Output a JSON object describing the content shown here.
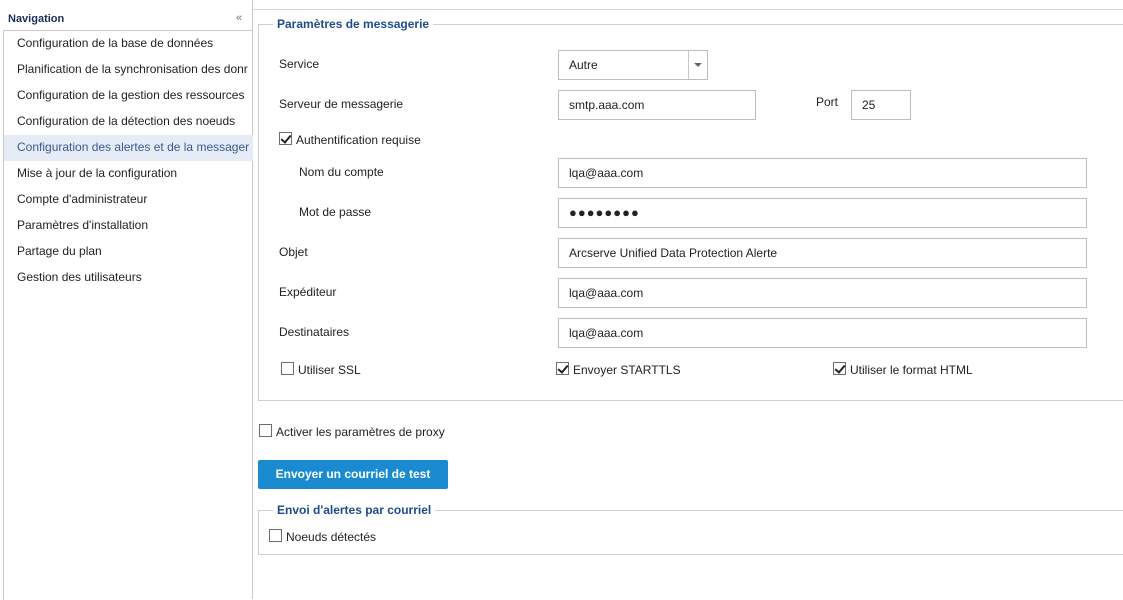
{
  "navigation": {
    "title": "Navigation",
    "items": [
      {
        "label": "Configuration de la base de données",
        "active": false
      },
      {
        "label": "Planification de la synchronisation des donr",
        "active": false
      },
      {
        "label": "Configuration de la gestion des ressources",
        "active": false
      },
      {
        "label": "Configuration de la détection des noeuds",
        "active": false
      },
      {
        "label": "Configuration des alertes et de la messager",
        "active": true
      },
      {
        "label": "Mise à jour de la configuration",
        "active": false
      },
      {
        "label": "Compte d'administrateur",
        "active": false
      },
      {
        "label": "Paramètres d'installation",
        "active": false
      },
      {
        "label": "Partage du plan",
        "active": false
      },
      {
        "label": "Gestion des utilisateurs",
        "active": false
      }
    ]
  },
  "mail": {
    "legend": "Paramètres de messagerie",
    "service_label": "Service",
    "service_value": "Autre",
    "server_label": "Serveur de messagerie",
    "server_value": "smtp.aaa.com",
    "port_label": "Port",
    "port_value": "25",
    "auth_label": "Authentification requise",
    "auth_checked": true,
    "account_label": "Nom du compte",
    "account_value": "lqa@aaa.com",
    "password_label": "Mot de passe",
    "password_value": "●●●●●●●●",
    "subject_label": "Objet",
    "subject_value": "Arcserve Unified Data Protection Alerte",
    "sender_label": "Expéditeur",
    "sender_value": "lqa@aaa.com",
    "recipients_label": "Destinataires",
    "recipients_value": "lqa@aaa.com",
    "ssl_label": "Utiliser SSL",
    "ssl_checked": false,
    "starttls_label": "Envoyer STARTTLS",
    "starttls_checked": true,
    "html_label": "Utiliser le format HTML",
    "html_checked": true
  },
  "proxy": {
    "label": "Activer les paramètres de proxy",
    "checked": false
  },
  "test_button_label": "Envoyer un courriel de test",
  "alerts": {
    "legend": "Envoi d'alertes par courriel",
    "nodes_label": "Noeuds détectés",
    "nodes_checked": false
  },
  "icons": {
    "collapse": "double-chevron-left-icon",
    "dropdown": "dropdown-arrow-icon"
  },
  "colors": {
    "accent_button": "#1a8bd1",
    "legend_text": "#1f4b8e",
    "active_nav_bg": "#e6ecf5"
  }
}
